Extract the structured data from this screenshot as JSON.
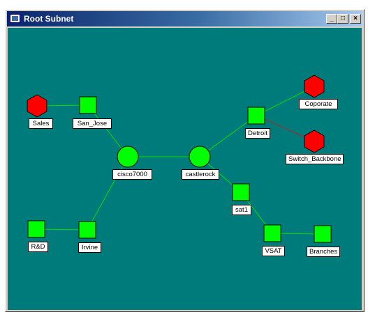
{
  "window": {
    "title": "Root Subnet",
    "icon": "app-window-icon",
    "buttons": {
      "minimize": "_",
      "maximize": "□",
      "close": "×"
    }
  },
  "colors": {
    "canvas_bg": "#007b7b",
    "router": "#00ff00",
    "switch": "#00ff00",
    "external": "#ff0000",
    "link_ok": "#00e000",
    "link_alert": "#b22222"
  },
  "network": {
    "nodes": [
      {
        "id": "sales",
        "label": "Sales",
        "shape": "hexagon-red"
      },
      {
        "id": "san_jose",
        "label": "San_Jose",
        "shape": "square-green"
      },
      {
        "id": "cisco7000",
        "label": "cisco7000",
        "shape": "circle-green"
      },
      {
        "id": "castlerock",
        "label": "castlerock",
        "shape": "circle-green"
      },
      {
        "id": "detroit",
        "label": "Detroit",
        "shape": "square-green"
      },
      {
        "id": "coporate",
        "label": "Coporate",
        "shape": "hexagon-red"
      },
      {
        "id": "switch_backbone",
        "label": "Switch_Backbone",
        "shape": "hexagon-red"
      },
      {
        "id": "sat1",
        "label": "sat1",
        "shape": "square-green"
      },
      {
        "id": "vsat",
        "label": "VSAT",
        "shape": "square-green"
      },
      {
        "id": "branches",
        "label": "Branches",
        "shape": "square-green"
      },
      {
        "id": "rnd",
        "label": "R&D",
        "shape": "square-green"
      },
      {
        "id": "irvine",
        "label": "Irvine",
        "shape": "square-green"
      }
    ],
    "links": [
      {
        "from": "sales",
        "to": "san_jose",
        "status": "ok"
      },
      {
        "from": "san_jose",
        "to": "cisco7000",
        "status": "ok"
      },
      {
        "from": "cisco7000",
        "to": "castlerock",
        "status": "ok"
      },
      {
        "from": "cisco7000",
        "to": "irvine",
        "status": "ok"
      },
      {
        "from": "irvine",
        "to": "rnd",
        "status": "ok"
      },
      {
        "from": "castlerock",
        "to": "detroit",
        "status": "ok"
      },
      {
        "from": "castlerock",
        "to": "sat1",
        "status": "ok"
      },
      {
        "from": "detroit",
        "to": "coporate",
        "status": "ok"
      },
      {
        "from": "detroit",
        "to": "switch_backbone",
        "status": "alert"
      },
      {
        "from": "sat1",
        "to": "vsat",
        "status": "ok"
      },
      {
        "from": "vsat",
        "to": "branches",
        "status": "ok"
      }
    ]
  }
}
